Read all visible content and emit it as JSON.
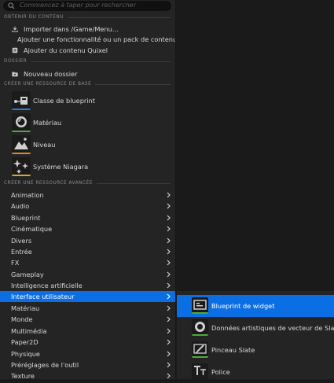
{
  "search": {
    "placeholder": "Commencez à taper pour rechercher"
  },
  "sections": {
    "content": "OBTENIR DU CONTENU",
    "folder": "DOSSIER",
    "basic": "CRÉER UNE RESSOURCE DE BASE",
    "advanced": "CRÉER UNE RESSOURCE AVANCÉE"
  },
  "content_items": [
    {
      "label": "Importer dans /Game/Menu...",
      "icon": "import-icon"
    },
    {
      "label": "Ajouter une fonctionnalité ou un pack de contenu...",
      "icon": "add-feature-icon"
    },
    {
      "label": "Ajouter du contenu Quixel",
      "icon": "quixel-icon"
    }
  ],
  "folder_items": [
    {
      "label": "Nouveau dossier",
      "icon": "new-folder-icon"
    }
  ],
  "basic_assets": [
    {
      "label": "Classe de blueprint",
      "icon": "blueprint-class-icon",
      "color": "#2b7bd9"
    },
    {
      "label": "Matériau",
      "icon": "material-icon",
      "color": "#4fa93b"
    },
    {
      "label": "Niveau",
      "icon": "level-icon",
      "color": "#e08a20"
    },
    {
      "label": "Système Niagara",
      "icon": "niagara-icon",
      "color": "#d9a830"
    }
  ],
  "advanced_categories": [
    "Animation",
    "Audio",
    "Blueprint",
    "Cinématique",
    "Divers",
    "Entrée",
    "FX",
    "Gameplay",
    "Intelligence artificielle",
    "Interface utilisateur",
    "Matériau",
    "Monde",
    "Multimédia",
    "Paper2D",
    "Physique",
    "Préréglages de l'outil",
    "Texture"
  ],
  "selected_category": "Interface utilisateur",
  "submenu": [
    {
      "label": "Blueprint de widget",
      "icon": "widget-blueprint-icon",
      "selected": true
    },
    {
      "label": "Données artistiques de vecteur de Slate",
      "icon": "slate-vector-icon",
      "selected": false
    },
    {
      "label": "Pinceau Slate",
      "icon": "slate-brush-icon",
      "selected": false
    },
    {
      "label": "Police",
      "icon": "font-icon",
      "selected": false
    }
  ],
  "colors": {
    "accent": "#0c6ee3",
    "bar_green": "#4fa93b"
  }
}
